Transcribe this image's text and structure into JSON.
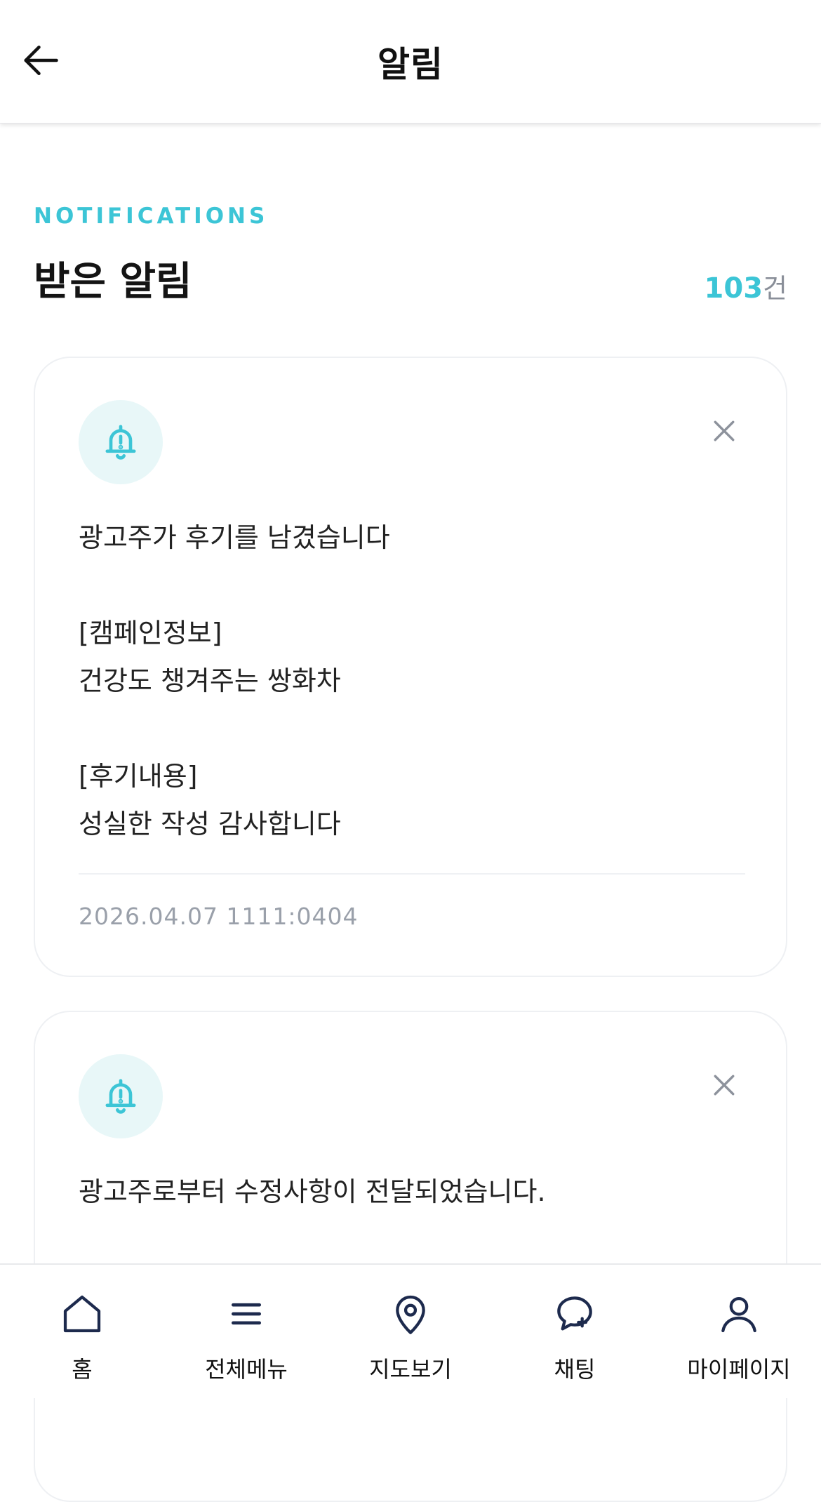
{
  "colors": {
    "accent": "#3cc5d6",
    "icon_navy": "#1d2a4d",
    "muted": "#9aa0aa"
  },
  "header": {
    "title": "알림",
    "back_icon": "arrow-left-icon"
  },
  "section": {
    "eyebrow": "NOTIFICATIONS",
    "title": "받은 알림",
    "count_number": "103",
    "count_unit": "건"
  },
  "notifications": [
    {
      "icon": "bell-alert-icon",
      "close_icon": "close-icon",
      "headline": "광고주가 후기를 남겼습니다",
      "campaign_label": "[캠페인정보]",
      "campaign_value": "건강도 챙겨주는 쌍화차",
      "review_label": "[후기내용]",
      "review_value": "성실한 작성 감사합니다",
      "date": "2026.04.07 1111:0404"
    },
    {
      "icon": "bell-alert-icon",
      "close_icon": "close-icon",
      "headline": "광고주로부터 수정사항이 전달되었습니다."
    }
  ],
  "bottom_nav": [
    {
      "label": "홈",
      "icon": "home-icon"
    },
    {
      "label": "전체메뉴",
      "icon": "menu-icon"
    },
    {
      "label": "지도보기",
      "icon": "map-pin-icon"
    },
    {
      "label": "채팅",
      "icon": "chat-icon"
    },
    {
      "label": "마이페이지",
      "icon": "user-icon"
    }
  ]
}
